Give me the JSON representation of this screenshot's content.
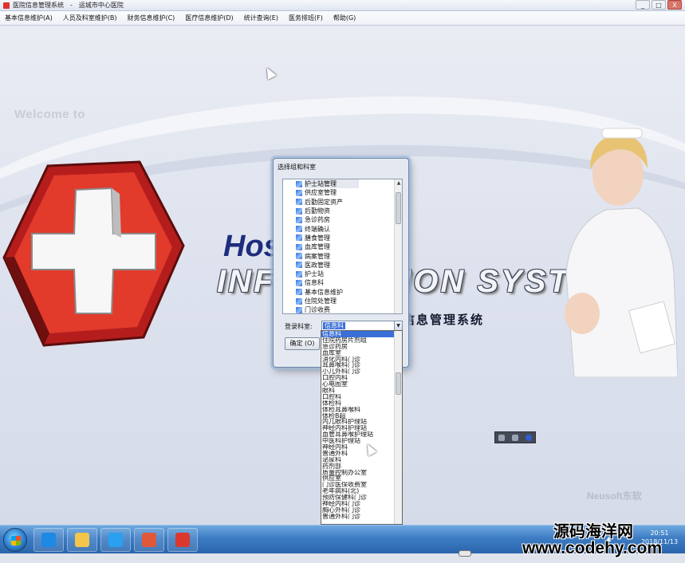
{
  "window": {
    "title": "医院信息管理系统",
    "separator": "-",
    "hospital": "运城市中心医院",
    "controls": [
      "_",
      "□",
      "X"
    ]
  },
  "menu": [
    "基本信息维护(A)",
    "人员及科室维护(B)",
    "财务信息维护(C)",
    "医疗信息维护(D)",
    "统计查询(E)",
    "医务排班(F)",
    "帮助(G)"
  ],
  "splash": {
    "welcome": "Welcome to",
    "hos": "Hos",
    "info_system": "INFORMATION SYSTEM",
    "cn_title": "信息管理系统",
    "brand": "Neusoft东软"
  },
  "dialog": {
    "title": "选择组和科室",
    "tree_items": [
      {
        "icon": "book-icon",
        "label": "护士站管理",
        "selected": true
      },
      {
        "icon": "book-icon",
        "label": "供应室管理"
      },
      {
        "icon": "book-icon",
        "label": "后勤固定资产"
      },
      {
        "icon": "book-icon",
        "label": "后勤物资"
      },
      {
        "icon": "book-icon",
        "label": "急诊药房"
      },
      {
        "icon": "book-icon",
        "label": "终端确认"
      },
      {
        "icon": "book-icon",
        "label": "膳食管理"
      },
      {
        "icon": "book-icon",
        "label": "血库管理"
      },
      {
        "icon": "book-icon",
        "label": "病案管理"
      },
      {
        "icon": "book-icon",
        "label": "医政管理"
      },
      {
        "icon": "book-icon",
        "label": "护士站"
      },
      {
        "icon": "book-icon",
        "label": "信息科"
      },
      {
        "icon": "book-icon",
        "label": "基本信息维护"
      },
      {
        "icon": "book-icon",
        "label": "住院处管理"
      },
      {
        "icon": "book-icon",
        "label": "门诊收费"
      }
    ],
    "dept_label": "登录科室:",
    "dept_value": "信息科",
    "ok_label": "确定 (O)"
  },
  "dropdown_options": [
    {
      "label": "信息科",
      "highlighted": true
    },
    {
      "label": "住院药房片剂组"
    },
    {
      "label": "急诊药房"
    },
    {
      "label": "血库室"
    },
    {
      "label": "消化内科门诊"
    },
    {
      "label": "耳鼻喉科门诊"
    },
    {
      "label": "小儿外科门诊"
    },
    {
      "label": "口腔内科"
    },
    {
      "label": "心电图室"
    },
    {
      "label": "眼科"
    },
    {
      "label": "口腔科"
    },
    {
      "label": "体检科"
    },
    {
      "label": "体检耳鼻喉科"
    },
    {
      "label": "体检B超"
    },
    {
      "label": "内儿眼科护理站"
    },
    {
      "label": "神经内科护理站"
    },
    {
      "label": "血管耳鼻喉护理站"
    },
    {
      "label": "中医科护理站"
    },
    {
      "label": "神经内科"
    },
    {
      "label": "普通外科"
    },
    {
      "label": "泌尿科"
    },
    {
      "label": "药剂部"
    },
    {
      "label": "质量控制办公室"
    },
    {
      "label": "供应室"
    },
    {
      "label": "门诊医保收费室"
    },
    {
      "label": "老年病科(北)"
    },
    {
      "label": "预防保健科门诊"
    },
    {
      "label": "神经内科门诊"
    },
    {
      "label": "胸心外科门诊"
    },
    {
      "label": "普通外科门诊"
    }
  ],
  "taskbar": {
    "apps": [
      {
        "name": "ie",
        "color": "#1e88e5"
      },
      {
        "name": "explorer",
        "color": "#f3c54b"
      },
      {
        "name": "ie2",
        "color": "#2aa0f0"
      },
      {
        "name": "media",
        "color": "#e0583a"
      },
      {
        "name": "his-app",
        "color": "#d9382f"
      }
    ],
    "time": "20:51",
    "date": "2018/11/13"
  },
  "watermark": {
    "line1": "源码海洋网",
    "line2": "www.codehy.com"
  }
}
